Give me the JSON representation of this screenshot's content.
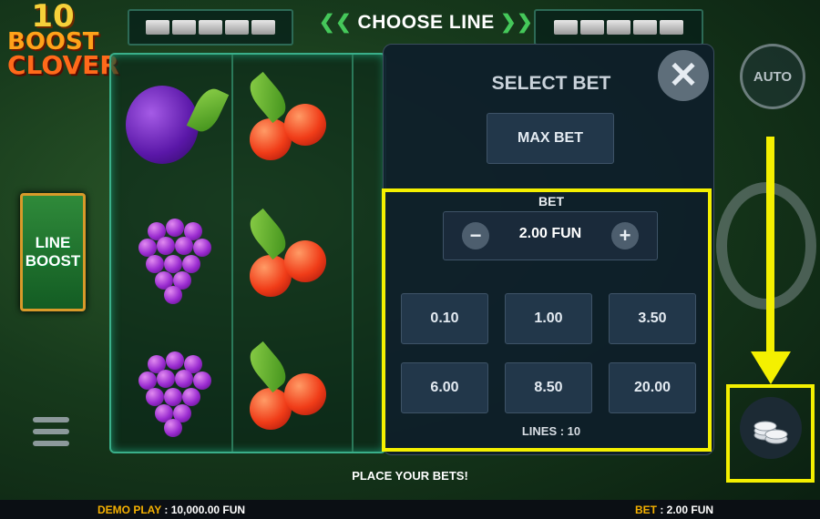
{
  "logo": {
    "line1": "10",
    "line2": "BOOST",
    "line3": "CLOVER"
  },
  "line_boost": {
    "line1": "LINE",
    "line2": "BOOST"
  },
  "header": {
    "choose_line_label": "CHOOSE LINE",
    "arrow_left": "❮❮",
    "arrow_right": "❯❯"
  },
  "bet_panel": {
    "title": "SELECT BET",
    "close_glyph": "✕",
    "max_bet_label": "MAX BET",
    "bet_label": "BET",
    "minus_glyph": "−",
    "plus_glyph": "+",
    "current_bet": "2.00 FUN",
    "options": [
      "0.10",
      "1.00",
      "3.50",
      "6.00",
      "8.50",
      "20.00"
    ],
    "lines_text": "LINES : 10"
  },
  "controls": {
    "auto_label": "AUTO"
  },
  "status_message": "PLACE YOUR BETS!",
  "bottom_bar": {
    "demo_label": "DEMO PLAY",
    "demo_value": ": 10,000.00 FUN",
    "bet_label": "BET",
    "bet_value": ": 2.00 FUN"
  },
  "colors": {
    "highlight": "#f4f000",
    "accent_green": "#45c85a",
    "bottom_label": "#f4b000"
  },
  "icons": [
    "close-icon",
    "auto-icon",
    "spin-icon",
    "coins-icon",
    "menu-icon",
    "down-arrow-annotation"
  ]
}
